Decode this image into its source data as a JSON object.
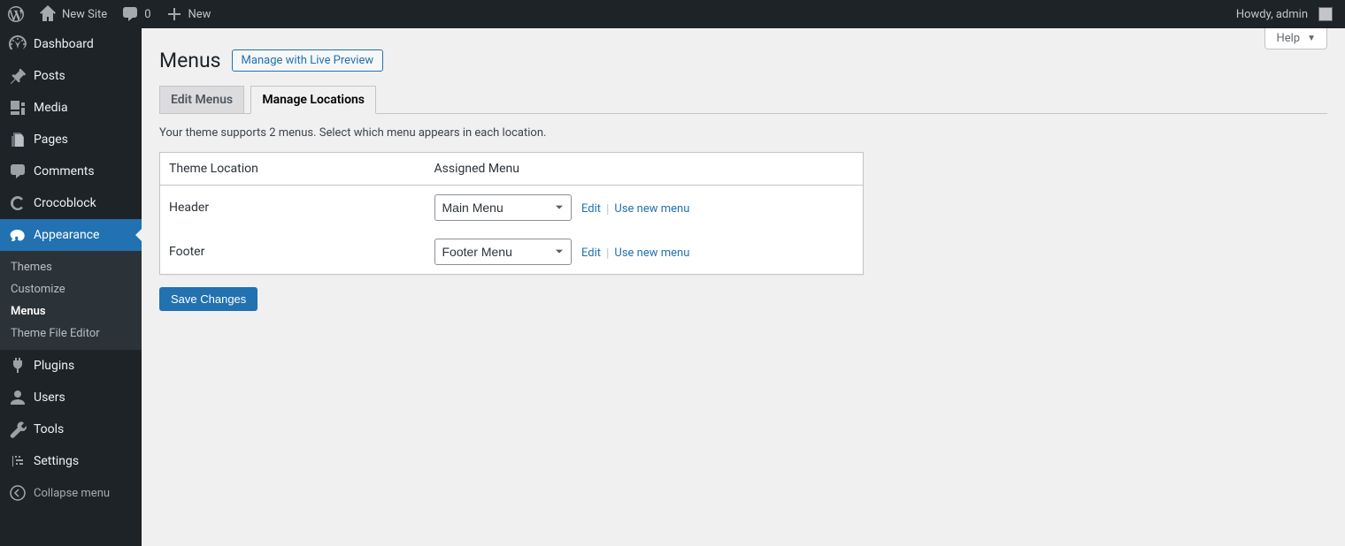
{
  "adminbar": {
    "site_name": "New Site",
    "comment_count": "0",
    "new_label": "New",
    "howdy": "Howdy, admin"
  },
  "sidebar": {
    "items": {
      "dashboard": "Dashboard",
      "posts": "Posts",
      "media": "Media",
      "pages": "Pages",
      "comments": "Comments",
      "crocoblock": "Crocoblock",
      "appearance": "Appearance",
      "plugins": "Plugins",
      "users": "Users",
      "tools": "Tools",
      "settings": "Settings"
    },
    "appearance_submenu": {
      "themes": "Themes",
      "customize": "Customize",
      "menus": "Menus",
      "editor": "Theme File Editor"
    },
    "collapse_label": "Collapse menu"
  },
  "screen": {
    "help_label": "Help",
    "title": "Menus",
    "live_preview_btn": "Manage with Live Preview",
    "tabs": {
      "edit": "Edit Menus",
      "locations": "Manage Locations"
    },
    "description": "Your theme supports 2 menus. Select which menu appears in each location.",
    "table": {
      "th_location": "Theme Location",
      "th_assigned": "Assigned Menu",
      "rows": [
        {
          "location": "Header",
          "selected": "Main Menu",
          "edit": "Edit",
          "use_new": "Use new menu"
        },
        {
          "location": "Footer",
          "selected": "Footer Menu",
          "edit": "Edit",
          "use_new": "Use new menu"
        }
      ]
    },
    "save_label": "Save Changes"
  }
}
